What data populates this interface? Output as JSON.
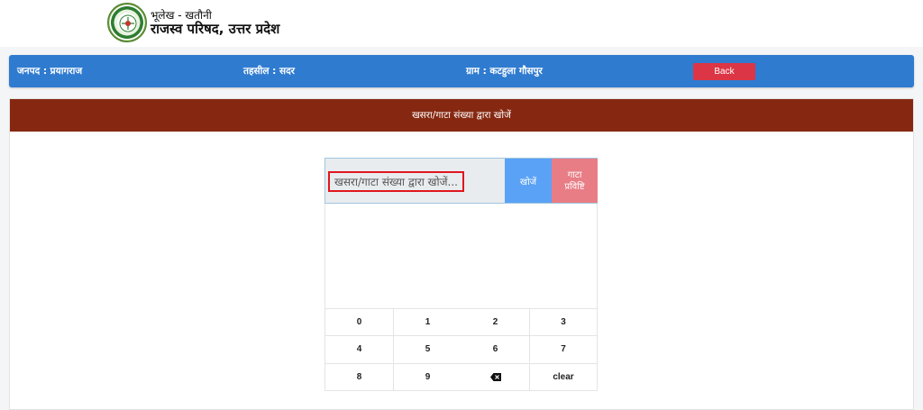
{
  "header": {
    "subtitle": "भूलेख - खतौनी",
    "title": "राजस्व परिषद, उत्तर प्रदेश",
    "logo_icon": "seal-logo"
  },
  "info_bar": {
    "district": "जनपद : प्रयागराज",
    "tehsil": "तहसील : सदर",
    "village": "ग्राम : कटहुला गौसपुर",
    "back_label": "Back"
  },
  "panel": {
    "heading": "खसरा/गाटा संख्या द्वारा खोजें"
  },
  "search": {
    "placeholder": "खसरा/गाटा संख्या द्वारा खोजें...",
    "search_label": "खोजें",
    "gata_label_line1": "गाटा",
    "gata_label_line2": "प्रविष्टि"
  },
  "keypad": {
    "keys": [
      "0",
      "1",
      "2",
      "3",
      "4",
      "5",
      "6",
      "7",
      "8",
      "9",
      "backspace",
      "clear"
    ],
    "backspace_icon": "backspace-icon"
  },
  "colors": {
    "info_bar": "#2f7bd0",
    "panel_head": "#862811",
    "back_button": "#dc3545",
    "search_button": "#5aa2f5",
    "gata_button": "#e87d86",
    "highlight_border": "#e0161e"
  }
}
